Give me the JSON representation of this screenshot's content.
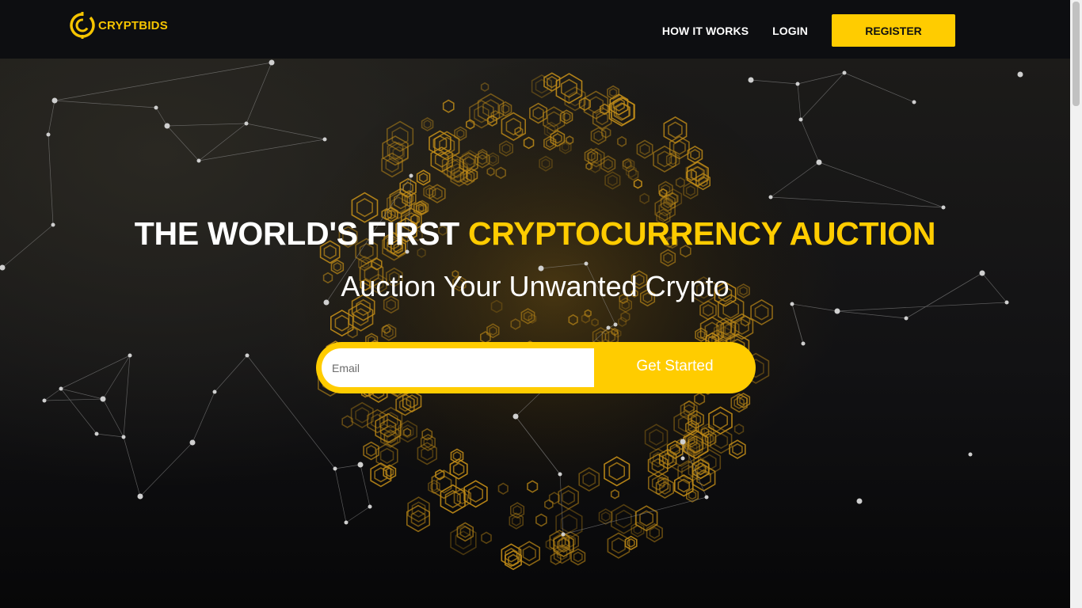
{
  "brand": {
    "name": "CRYPTBIDS",
    "logo_icon": "coin-c-logo-icon",
    "accent_color": "#ffcc00"
  },
  "nav": {
    "links": [
      {
        "label": "HOW IT WORKS"
      },
      {
        "label": "LOGIN"
      }
    ],
    "register_label": "REGISTER"
  },
  "hero": {
    "headline_white": "THE WORLD'S FIRST ",
    "headline_accent": "CRYPTOCURRENCY AUCTION",
    "subheadline": "Auction Your Unwanted Crypto",
    "email_placeholder": "Email",
    "cta_label": "Get Started"
  },
  "colors": {
    "navbar_bg": "#0d0e11",
    "accent": "#ffcc00",
    "text": "#ffffff"
  }
}
